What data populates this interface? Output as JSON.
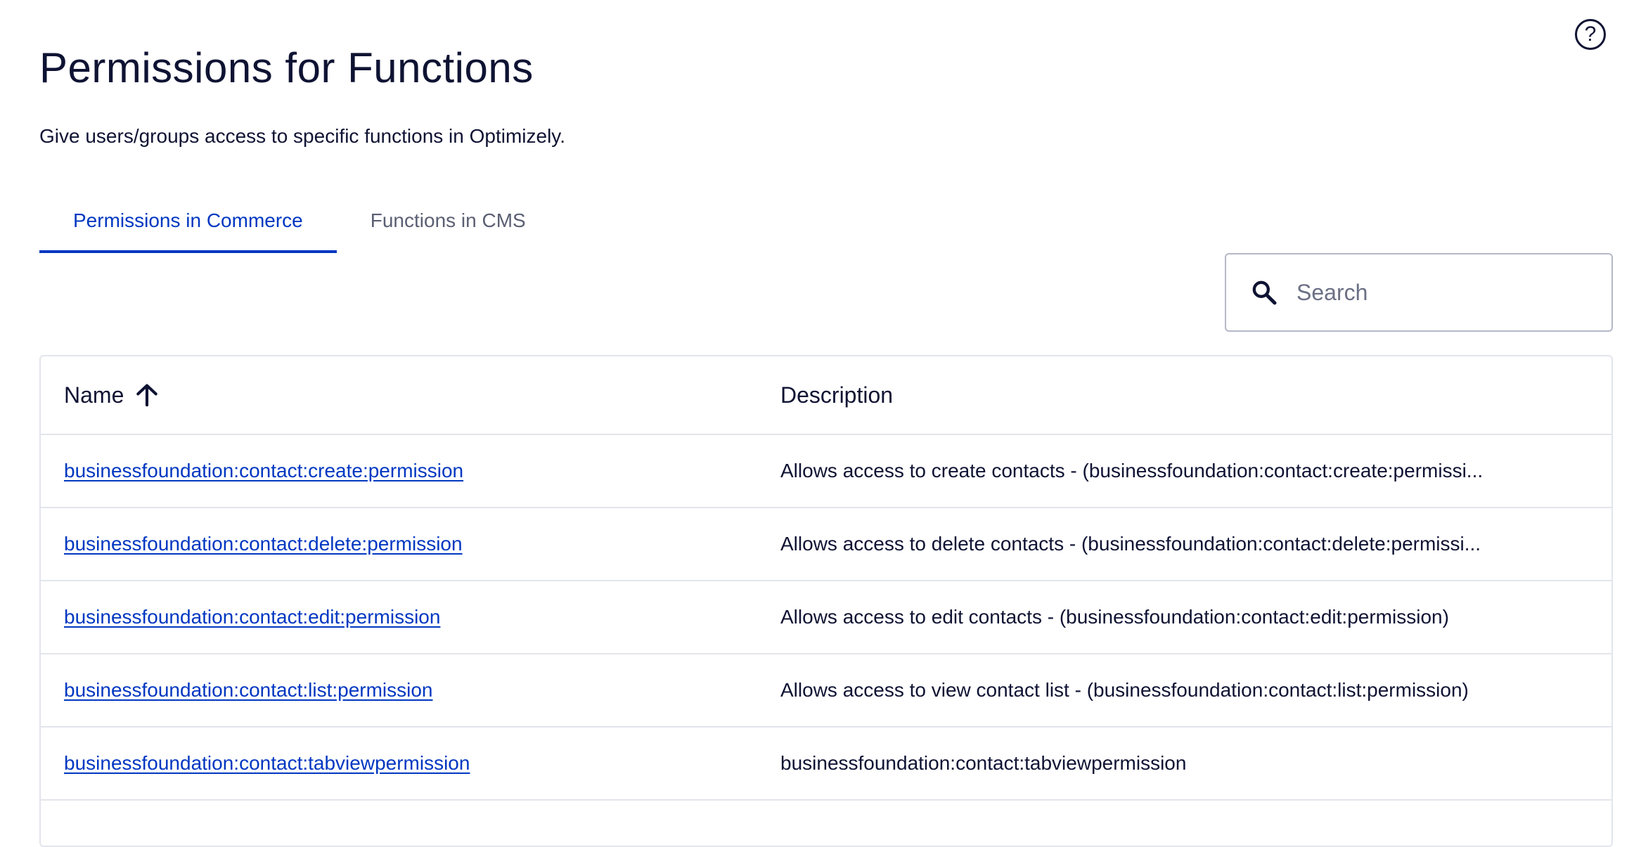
{
  "page": {
    "title": "Permissions for Functions",
    "subtitle": "Give users/groups access to specific functions in Optimizely.",
    "help_label": "?"
  },
  "tabs": [
    {
      "label": "Permissions in Commerce",
      "active": true
    },
    {
      "label": "Functions in CMS",
      "active": false
    }
  ],
  "search": {
    "placeholder": "Search",
    "value": ""
  },
  "table": {
    "columns": {
      "name": "Name",
      "description": "Description"
    },
    "sort": {
      "column": "name",
      "direction": "ascending"
    },
    "rows": [
      {
        "name": "businessfoundation:contact:create:permission",
        "description": "Allows access to create contacts - (businessfoundation:contact:create:permissi..."
      },
      {
        "name": "businessfoundation:contact:delete:permission",
        "description": "Allows access to delete contacts - (businessfoundation:contact:delete:permissi..."
      },
      {
        "name": "businessfoundation:contact:edit:permission",
        "description": "Allows access to edit contacts - (businessfoundation:contact:edit:permission)"
      },
      {
        "name": "businessfoundation:contact:list:permission",
        "description": "Allows access to view contact list - (businessfoundation:contact:list:permission)"
      },
      {
        "name": "businessfoundation:contact:tabviewpermission",
        "description": "businessfoundation:contact:tabviewpermission"
      }
    ]
  },
  "colors": {
    "accent": "#0037c1",
    "text": "#0f1333",
    "muted": "#5a5f73",
    "border": "#e3e5ec"
  },
  "icons": {
    "help": "question-circle-icon",
    "search": "search-icon",
    "sort": "arrow-up-icon"
  }
}
